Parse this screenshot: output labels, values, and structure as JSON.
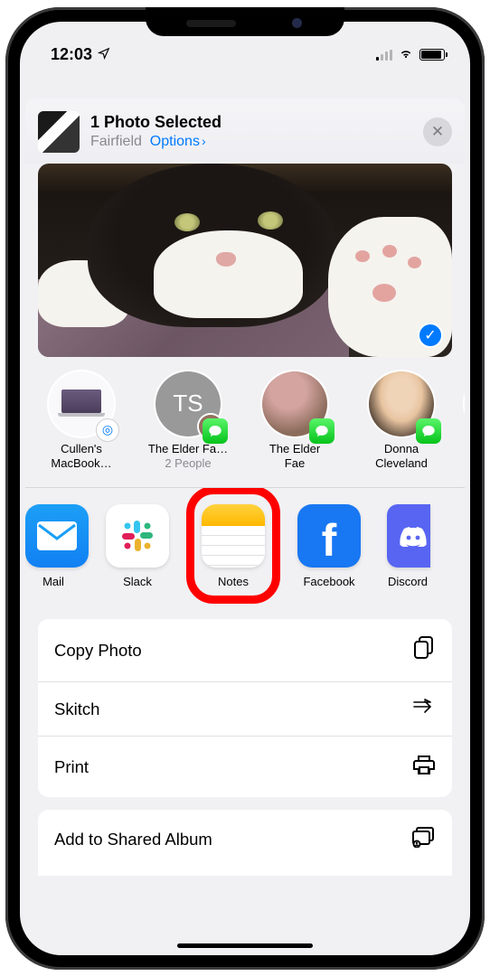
{
  "status": {
    "time": "12:03"
  },
  "header": {
    "title": "1 Photo Selected",
    "location": "Fairfield",
    "options_label": "Options"
  },
  "contacts": [
    {
      "line1": "Cullen's",
      "line2": "MacBook…",
      "type": "airdrop"
    },
    {
      "line1": "The Elder Fa…",
      "line2": "2 People",
      "type": "group",
      "initials": "TS"
    },
    {
      "line1": "The Elder",
      "line2": "Fae",
      "type": "imessage"
    },
    {
      "line1": "Donna",
      "line2": "Cleveland",
      "type": "imessage"
    }
  ],
  "apps": [
    {
      "label": "Mail"
    },
    {
      "label": "Slack"
    },
    {
      "label": "Notes",
      "highlighted": true
    },
    {
      "label": "Facebook"
    },
    {
      "label": "Discord"
    }
  ],
  "actions": [
    {
      "label": "Copy Photo",
      "icon": "copy"
    },
    {
      "label": "Skitch",
      "icon": "skitch"
    },
    {
      "label": "Print",
      "icon": "print"
    }
  ],
  "actions2": [
    {
      "label": "Add to Shared Album",
      "icon": "shared-album"
    }
  ],
  "colors": {
    "accent": "#007aff",
    "highlight": "#ff0000"
  }
}
